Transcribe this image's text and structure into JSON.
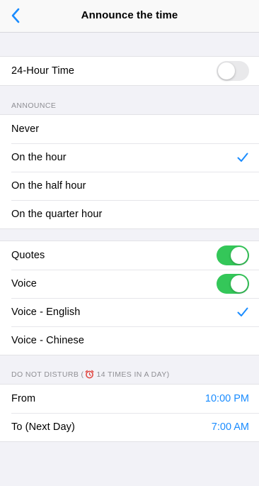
{
  "nav": {
    "title": "Announce the time",
    "back_icon": "chevron-left-icon"
  },
  "settings": {
    "twenty_four_hour": {
      "label": "24-Hour Time",
      "enabled": false
    }
  },
  "announce": {
    "header": "ANNOUNCE",
    "options": [
      {
        "label": "Never",
        "selected": false
      },
      {
        "label": "On the hour",
        "selected": true
      },
      {
        "label": "On the half hour",
        "selected": false
      },
      {
        "label": "On the quarter hour",
        "selected": false
      }
    ]
  },
  "content": {
    "quotes": {
      "label": "Quotes",
      "enabled": true
    },
    "voice": {
      "label": "Voice",
      "enabled": true
    },
    "voice_options": [
      {
        "label": "Voice - English",
        "selected": true
      },
      {
        "label": "Voice - Chinese",
        "selected": false
      }
    ]
  },
  "dnd": {
    "header_prefix": "DO NOT DISTURB (",
    "header_icon": "alarm-clock-icon",
    "header_suffix": " 14 TIMES IN A DAY)",
    "from": {
      "label": "From",
      "value": "10:00 PM"
    },
    "to": {
      "label": "To (Next Day)",
      "value": "7:00 AM"
    }
  },
  "colors": {
    "accent": "#1a8cff",
    "switch_on": "#34c759",
    "switch_off": "#e9e9eb",
    "background": "#f2f2f7",
    "alarm_icon": "#e0443e"
  }
}
